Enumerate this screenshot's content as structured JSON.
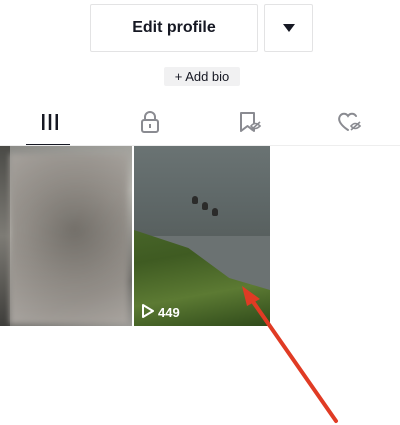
{
  "profile": {
    "edit_label": "Edit profile",
    "more_icon": "caret-down-icon",
    "add_bio_label": "+ Add bio"
  },
  "tabs": [
    {
      "name": "videos",
      "icon": "grid-icon",
      "active": true
    },
    {
      "name": "private",
      "icon": "lock-icon",
      "active": false
    },
    {
      "name": "favorites",
      "icon": "bookmark-hidden-icon",
      "active": false
    },
    {
      "name": "liked",
      "icon": "heart-hidden-icon",
      "active": false
    }
  ],
  "videos": [
    {
      "views": ""
    },
    {
      "views": "449"
    }
  ],
  "annotation": {
    "arrow_color": "#e03b24"
  },
  "colors": {
    "text": "#161823",
    "border": "#e3e3e4",
    "bio_bg": "#f1f1f2"
  }
}
